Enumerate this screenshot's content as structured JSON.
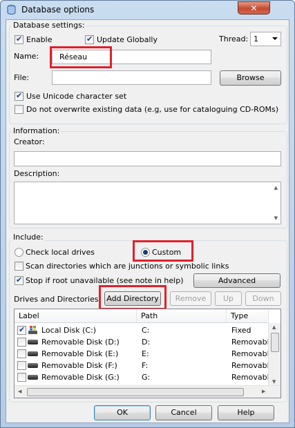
{
  "window": {
    "title": "Database options",
    "close_label": "✕"
  },
  "settings": {
    "legend": "Database settings:",
    "enable_label": "Enable",
    "update_globally_label": "Update Globally",
    "thread_label": "Thread:",
    "thread_value": "1",
    "name_label": "Name:",
    "name_value": "Réseau",
    "file_label": "File:",
    "file_value": "",
    "browse_label": "Browse",
    "unicode_label": "Use Unicode character set",
    "no_overwrite_label": "Do not overwrite existing data (e.g, use for cataloguing CD-ROMs)"
  },
  "information": {
    "legend": "Information:",
    "creator_label": "Creator:",
    "creator_value": "",
    "description_label": "Description:",
    "description_value": ""
  },
  "include": {
    "legend": "Include:",
    "check_local_label": "Check local drives",
    "custom_label": "Custom",
    "scan_junctions_label": "Scan directories which are junctions or symbolic links",
    "stop_root_label": "Stop if root unavailable (see note in help)",
    "advanced_label": "Advanced",
    "drives_label": "Drives and Directories:",
    "add_directory_label": "Add Directory",
    "remove_label": "Remove",
    "up_label": "Up",
    "down_label": "Down"
  },
  "table": {
    "columns": [
      "Label",
      "Path",
      "Type"
    ],
    "rows": [
      {
        "label": "Local Disk (C:)",
        "path": "C:",
        "type": "Fixed",
        "checked": true
      },
      {
        "label": "Removable Disk (D:)",
        "path": "D:",
        "type": "Removable",
        "checked": false
      },
      {
        "label": "Removable Disk (E:)",
        "path": "E:",
        "type": "Removable",
        "checked": false
      },
      {
        "label": "Removable Disk (F:)",
        "path": "F:",
        "type": "Removable",
        "checked": false
      },
      {
        "label": "Removable Disk (G:)",
        "path": "G:",
        "type": "Removable",
        "checked": false
      }
    ]
  },
  "footer": {
    "ok_label": "OK",
    "cancel_label": "Cancel",
    "help_label": "Help"
  }
}
